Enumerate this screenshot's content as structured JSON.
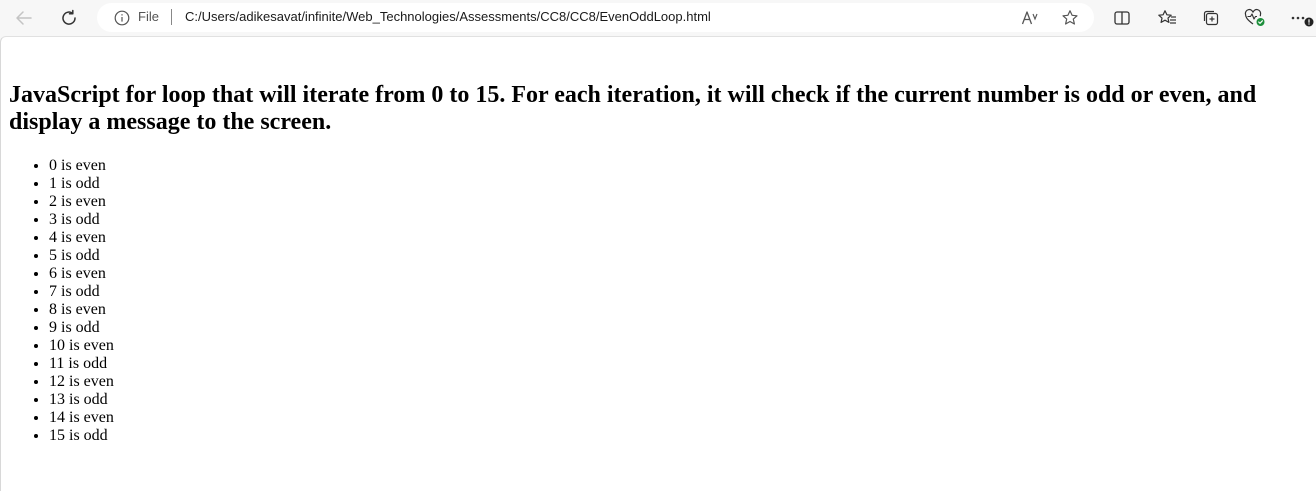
{
  "browser": {
    "address_scheme_label": "File",
    "url": "C:/Users/adikesavat/infinite/Web_Technologies/Assessments/CC8/CC8/EvenOddLoop.html"
  },
  "page": {
    "heading": "JavaScript for loop that will iterate from 0 to 15. For each iteration, it will check if the current number is odd or even, and display a message to the screen.",
    "items": [
      "0 is even",
      "1 is odd",
      "2 is even",
      "3 is odd",
      "4 is even",
      "5 is odd",
      "6 is even",
      "7 is odd",
      "8 is even",
      "9 is odd",
      "10 is even",
      "11 is odd",
      "12 is even",
      "13 is odd",
      "14 is even",
      "15 is odd"
    ]
  },
  "icons": {
    "back": "back-arrow-icon",
    "refresh": "refresh-icon",
    "info": "info-icon",
    "read_aloud": "read-aloud-icon",
    "favorite": "star-icon",
    "split_screen": "split-screen-icon",
    "favorites_list": "favorites-icon",
    "collections": "collections-icon",
    "browser_essentials": "heart-pulse-icon",
    "more": "more-icon"
  }
}
